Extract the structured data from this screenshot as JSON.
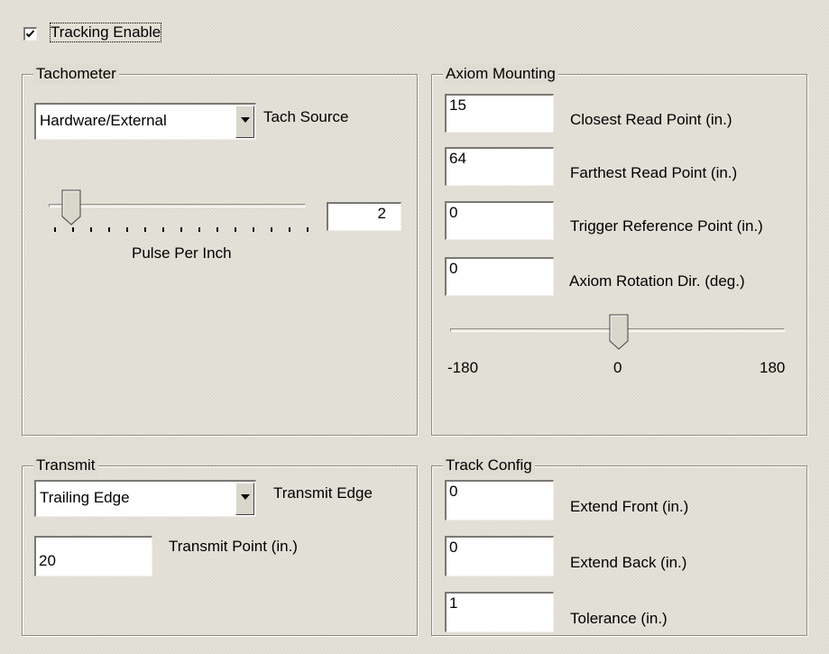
{
  "tracking": {
    "label": "Tracking Enable",
    "checked": true
  },
  "tachometer": {
    "title": "Tachometer",
    "source_value": "Hardware/External",
    "source_label": "Tach Source",
    "pulse_value": "2",
    "pulse_label": "Pulse Per Inch"
  },
  "axiom": {
    "title": "Axiom Mounting",
    "fields": [
      {
        "value": "15",
        "label": "Closest Read Point (in.)"
      },
      {
        "value": "64",
        "label": "Farthest Read Point (in.)"
      },
      {
        "value": "0",
        "label": "Trigger Reference Point (in.)"
      },
      {
        "value": "0",
        "label": "Axiom Rotation Dir. (deg.)"
      }
    ],
    "rotation_min": "-180",
    "rotation_mid": "0",
    "rotation_max": "180"
  },
  "transmit": {
    "title": "Transmit",
    "edge_value": "Trailing Edge",
    "edge_label": "Transmit Edge",
    "point_value": "20",
    "point_label": "Transmit Point (in.)"
  },
  "track_config": {
    "title": "Track Config",
    "fields": [
      {
        "value": "0",
        "label": "Extend Front (in.)"
      },
      {
        "value": "0",
        "label": "Extend Back (in.)"
      },
      {
        "value": "1",
        "label": "Tolerance (in.)"
      }
    ]
  }
}
